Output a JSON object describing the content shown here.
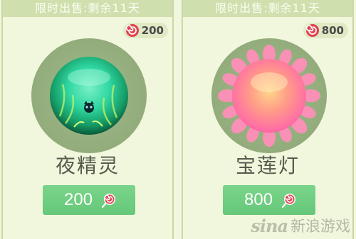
{
  "colors": {
    "background": "#f1f7dc",
    "banner": "#cfe0ae",
    "button": "#6fcf82",
    "halo": "#93ac7c",
    "candy": "#d63a4a"
  },
  "cards": [
    {
      "banner": "限时出售:剩余11天",
      "price_badge": "200",
      "name": "夜精灵",
      "buy_label": "200",
      "currency_icon": "lollipop-swirl-icon",
      "item_icon": "night-spirit-green-orb"
    },
    {
      "banner": "限时出售:剩余11天",
      "price_badge": "800",
      "name": "宝莲灯",
      "buy_label": "800",
      "currency_icon": "lollipop-swirl-icon",
      "item_icon": "lotus-lantern-pink-orb"
    }
  ],
  "watermark": {
    "logo": "sina",
    "text": "新浪游戏"
  }
}
